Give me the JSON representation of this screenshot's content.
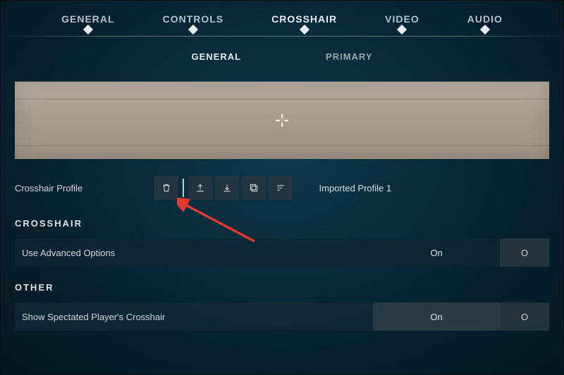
{
  "tabs": {
    "main": [
      "GENERAL",
      "CONTROLS",
      "CROSSHAIR",
      "VIDEO",
      "AUDIO"
    ],
    "activeMain": "CROSSHAIR",
    "sub": [
      "GENERAL",
      "PRIMARY"
    ],
    "activeSub": "GENERAL"
  },
  "profile": {
    "label": "Crosshair Profile",
    "icons": [
      "trash",
      "upload",
      "download",
      "copy",
      "edit-lines"
    ],
    "value": "Imported Profile 1"
  },
  "sections": {
    "crosshair": {
      "title": "CROSSHAIR",
      "settings": [
        {
          "label": "Use Advanced Options",
          "on": "On",
          "off": "O"
        }
      ]
    },
    "other": {
      "title": "OTHER",
      "settings": [
        {
          "label": "Show Spectated Player's Crosshair",
          "on": "On",
          "off": "O"
        }
      ]
    }
  },
  "colors": {
    "iconBg": "#22353f",
    "accent": "#e9edef"
  }
}
